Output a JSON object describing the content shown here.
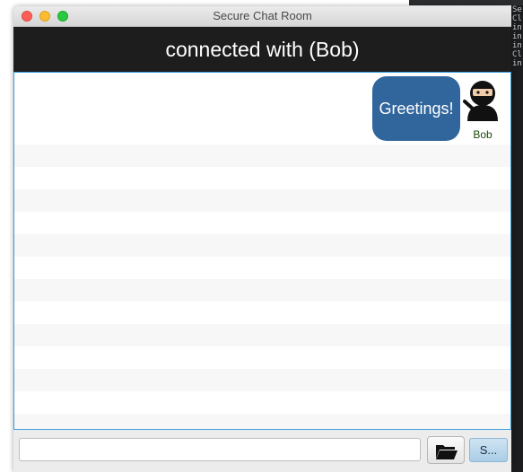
{
  "window": {
    "title": "Secure Chat Room"
  },
  "header": {
    "text": "connected with (Bob)"
  },
  "messages": [
    {
      "text": "Greetings!",
      "sender": "Bob",
      "avatar_icon": "ninja-avatar-icon",
      "bubble_color": "#31669d"
    }
  ],
  "composer": {
    "input_value": "",
    "file_button_icon": "folder-icon",
    "send_label": "S..."
  },
  "background_terminal": {
    "lines": "Se\nCl\nin\nin\nin\nCl\nin"
  },
  "colors": {
    "header_bg": "#1d1d1d",
    "chat_border": "#3a9fd8",
    "bubble": "#31669d",
    "send_button": "#a9cde6"
  }
}
